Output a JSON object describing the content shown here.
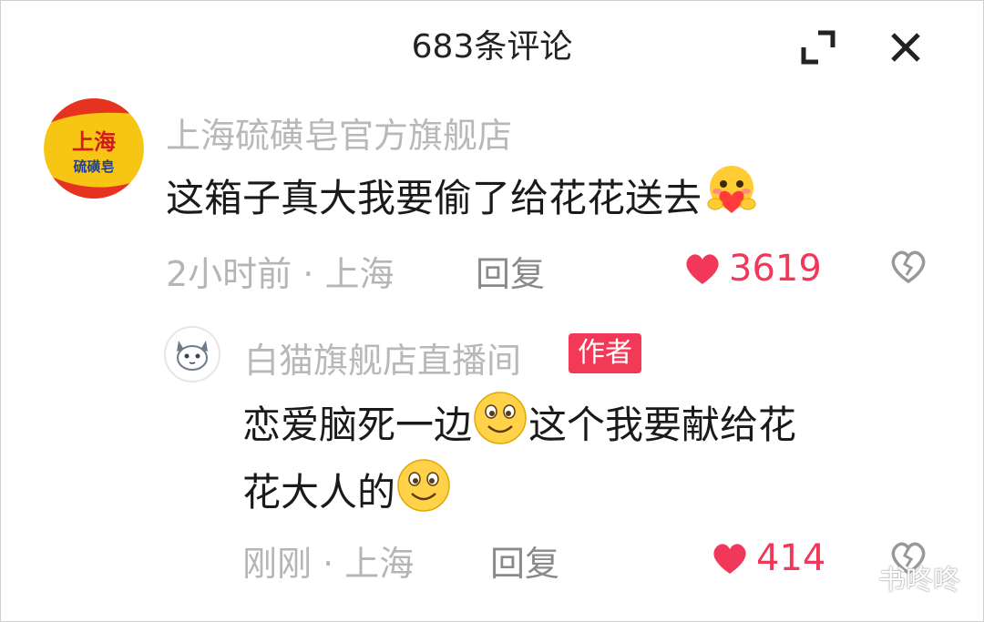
{
  "header": {
    "title": "683条评论"
  },
  "comments": [
    {
      "username": "上海硫磺皂官方旗舰店",
      "avatar_text": [
        "上海",
        "硫磺皂"
      ],
      "content": "这箱子真大我要偷了给花花送去",
      "time": "2小时前",
      "separator": "·",
      "location": "上海",
      "reply_label": "回复",
      "likes": "3619"
    }
  ],
  "reply": {
    "username": "白猫旗舰店直播间",
    "tag": "作者",
    "content_line1": "恋爱脑死一边",
    "content_line1_rest": "这个我要献给花",
    "content_line2": "花大人的",
    "time": "刚刚",
    "separator": "·",
    "location": "上海",
    "reply_label": "回复",
    "likes": "414"
  },
  "watermark": {
    "text": "书咚咚"
  },
  "colors": {
    "like_red": "#f2385a",
    "tag_red": "#f23a58",
    "muted": "#b5b5b5"
  }
}
